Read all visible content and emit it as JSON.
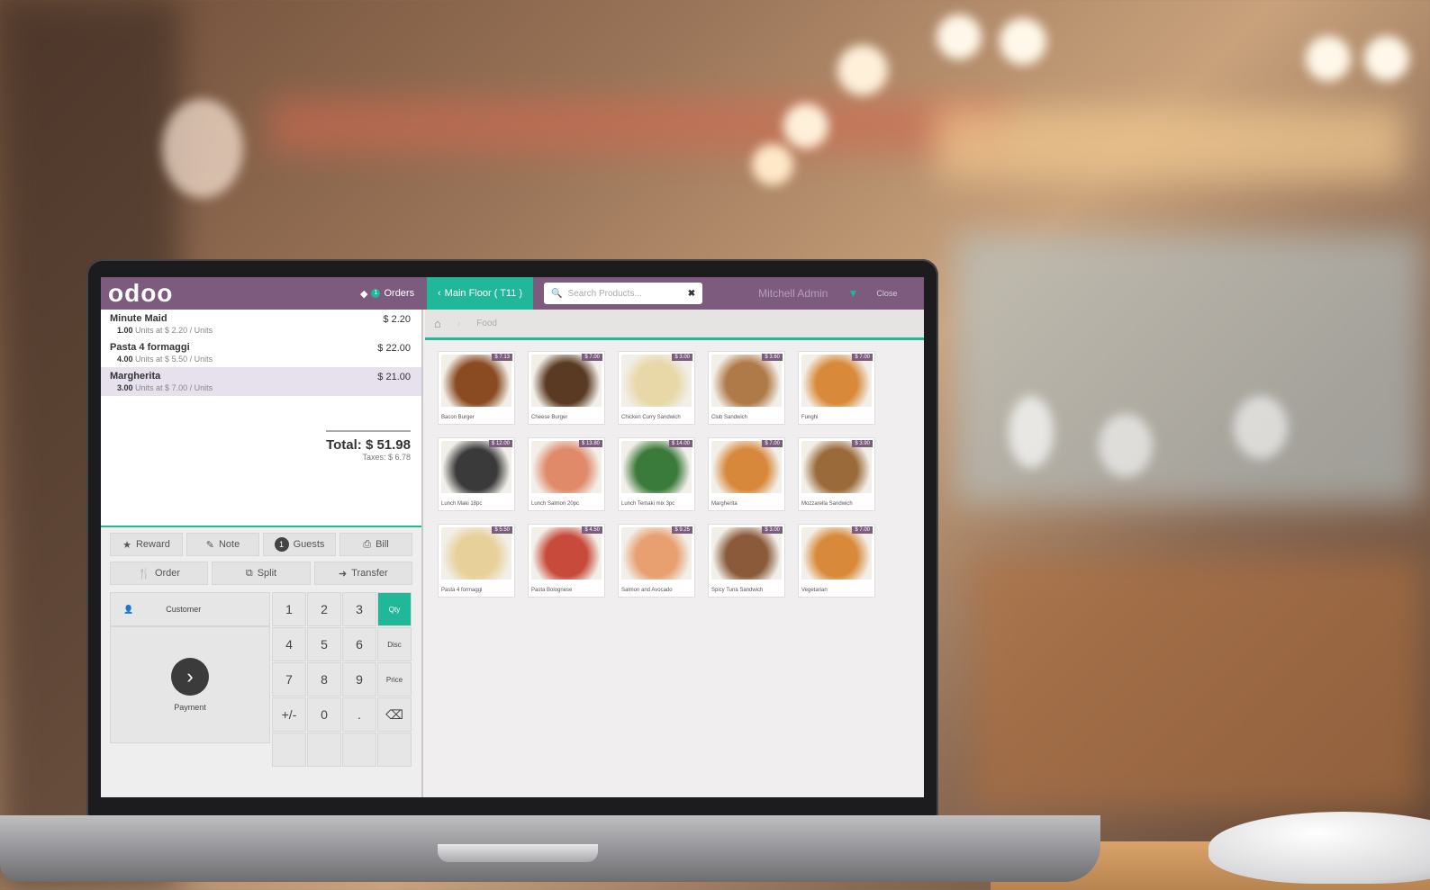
{
  "app": {
    "logo": "odoo"
  },
  "topbar": {
    "orders_label": "Orders",
    "orders_count": "1",
    "floor_tab": "Main Floor ( T11 )",
    "search_placeholder": "Search Products...",
    "cashier": "Mitchell Admin",
    "close_label": "Close"
  },
  "order": {
    "lines": [
      {
        "name": "Minute Maid",
        "price": "$ 2.20",
        "qty": "1.00",
        "info": "Units at $ 2.20 / Units"
      },
      {
        "name": "Pasta 4 formaggi",
        "price": "$ 22.00",
        "qty": "4.00",
        "info": "Units at $ 5.50 / Units"
      },
      {
        "name": "Margherita",
        "price": "$ 21.00",
        "qty": "3.00",
        "info": "Units at $ 7.00 / Units"
      }
    ],
    "total": "Total: $ 51.98",
    "taxes": "Taxes: $ 6.78"
  },
  "controls": {
    "reward": "Reward",
    "note": "Note",
    "guests": "Guests",
    "guests_count": "1",
    "bill": "Bill",
    "order": "Order",
    "split": "Split",
    "transfer": "Transfer",
    "customer": "Customer",
    "payment": "Payment"
  },
  "numpad": {
    "keys": [
      "1",
      "2",
      "3",
      "Qty",
      "4",
      "5",
      "6",
      "Disc",
      "7",
      "8",
      "9",
      "Price",
      "+/-",
      "0",
      ".",
      "⌫"
    ]
  },
  "breadcrumb": {
    "category": "Food"
  },
  "products": [
    {
      "name": "Bacon Burger",
      "price": "$ 7.13",
      "color": "#8a4a22"
    },
    {
      "name": "Cheese Burger",
      "price": "$ 7.00",
      "color": "#5a3a22"
    },
    {
      "name": "Chicken Curry Sandwich",
      "price": "$ 3.00",
      "color": "#e8d8a8"
    },
    {
      "name": "Club Sandwich",
      "price": "$ 3.60",
      "color": "#b07a48"
    },
    {
      "name": "Funghi",
      "price": "$ 7.00",
      "color": "#d88a3a"
    },
    {
      "name": "Lunch Maki 18pc",
      "price": "$ 12.00",
      "color": "#3a3a3a"
    },
    {
      "name": "Lunch Salmon 20pc",
      "price": "$ 13.80",
      "color": "#e08a6a"
    },
    {
      "name": "Lunch Temaki mix 3pc",
      "price": "$ 14.00",
      "color": "#3a7a3a"
    },
    {
      "name": "Margherita",
      "price": "$ 7.00",
      "color": "#d8883a"
    },
    {
      "name": "Mozzarella Sandwich",
      "price": "$ 3.90",
      "color": "#9a6a3a"
    },
    {
      "name": "Pasta 4 formaggi",
      "price": "$ 5.50",
      "color": "#e8d09a"
    },
    {
      "name": "Pasta Bolognese",
      "price": "$ 4.50",
      "color": "#c84a3a"
    },
    {
      "name": "Salmon and Avocado",
      "price": "$ 9.25",
      "color": "#e8a070"
    },
    {
      "name": "Spicy Tuna Sandwich",
      "price": "$ 3.00",
      "color": "#8a5a3a"
    },
    {
      "name": "Vegetarian",
      "price": "$ 7.00",
      "color": "#d88a3a"
    }
  ],
  "colors": {
    "brand": "#7c5b7f",
    "accent": "#21b799"
  }
}
